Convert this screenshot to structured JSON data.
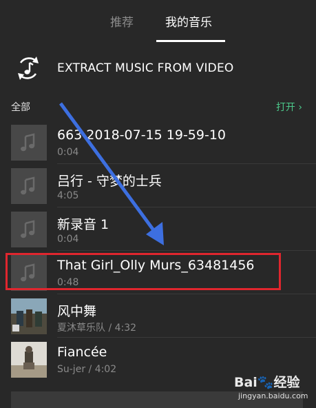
{
  "tabs": [
    {
      "label": "推荐",
      "active": false
    },
    {
      "label": "我的音乐",
      "active": true
    }
  ],
  "extract": {
    "label": "EXTRACT MUSIC FROM VIDEO",
    "icon": "music-convert-icon"
  },
  "section": {
    "all_label": "全部",
    "open_label": "打开 ›"
  },
  "songs": [
    {
      "title": "663 2018-07-15 19-59-10",
      "subtitle": "0:04",
      "thumb": "placeholder"
    },
    {
      "title": "吕行 - 守梦的士兵",
      "subtitle": "4:05",
      "thumb": "placeholder"
    },
    {
      "title": "新录音 1",
      "subtitle": "0:04",
      "thumb": "placeholder"
    },
    {
      "title": "That Girl_Olly Murs_63481456",
      "subtitle": "0:48",
      "thumb": "placeholder"
    },
    {
      "title": "风中舞",
      "subtitle": "夏沐草乐队 / 4:32",
      "thumb": "album-art"
    },
    {
      "title": "Fiancée",
      "subtitle": "Su-jer / 4:02",
      "thumb": "album-art"
    }
  ],
  "colors": {
    "background": "#282828",
    "accent_green": "#4cc98b",
    "highlight_red": "#e0262e",
    "arrow_blue": "#3d6fe0"
  },
  "watermark": {
    "logo": "Bai🐾经验",
    "url": "jingyan.baidu.com"
  }
}
